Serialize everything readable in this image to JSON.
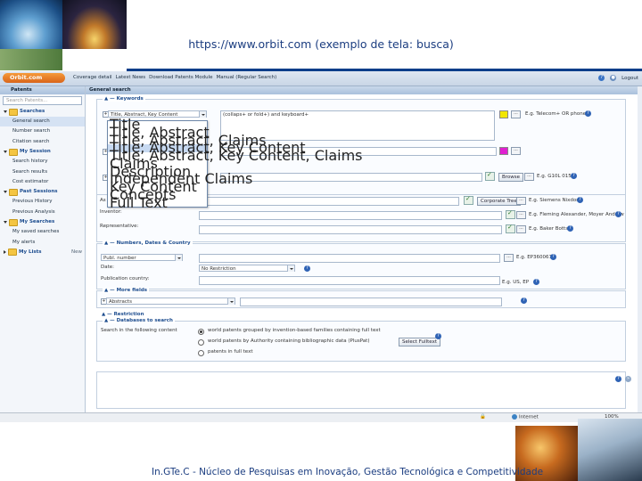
{
  "slide": {
    "title": "https://www.orbit.com (exemplo de tela: busca)",
    "footer": "In.GTe.C - Núcleo de Pesquisas em Inovação, Gestão Tecnológica e Competitividade"
  },
  "app": {
    "logo": "Orbit.com",
    "topnav": [
      "Coverage detail",
      "Latest News",
      "Download Patents Module",
      "Manual (Regular Search)"
    ],
    "logout": "Logout"
  },
  "sidebar": {
    "header": "Patents",
    "search_placeholder": "Search Patents...",
    "searches": {
      "title": "Searches",
      "items": [
        "General search",
        "Number search",
        "Citation search"
      ]
    },
    "my_session": {
      "title": "My Session",
      "items": [
        "Search history",
        "Search results",
        "Cost estimator"
      ]
    },
    "past_sessions": {
      "title": "Past Sessions",
      "items": [
        "Previous History",
        "Previous Analysis"
      ]
    },
    "my_searches": {
      "title": "My Searches",
      "items": [
        "My saved searches",
        "My alerts"
      ]
    },
    "my_lists": {
      "title": "My Lists",
      "new_label": "New"
    }
  },
  "main": {
    "header": "General search",
    "keywords": {
      "title": "Keywords",
      "field_select": "Title, Abstract, Key Content",
      "query": "(collaps+ or fold+) and keyboard+",
      "example": "E.g. Telecom+ OR phone"
    },
    "dropdown_options": [
      "Title",
      "Title, Abstract",
      "Title, Abstract, Claims",
      "Title, Abstract, Key Content",
      "Title, Abstract, Key Content, Claims",
      "Claims",
      "Description",
      "Independent Claims",
      "Key Content",
      "Concepts",
      "Full Text"
    ],
    "dropdown_highlighted": "Title, Abstract, Key Content",
    "classification": {
      "browse_label": "Browse",
      "example": "E.g. G10L 015"
    },
    "names": {
      "assignee_prefix": "As",
      "corporate_tree_label": "Corporate Tree",
      "assignee_example": "E.g. Siemens Nixdorf",
      "inventor_label": "Inventor:",
      "inventor_example": "E.g. Fleming Alexander, Moyer Andrew",
      "representative_label": "Representative:",
      "representative_example": "E.g. Baker Botts"
    },
    "numbers": {
      "title": "Numbers, Dates & Country",
      "number_select": "Publ. number",
      "number_example": "E.g. EP360067",
      "date_label": "Date:",
      "date_select": "No Restriction",
      "country_label": "Publication country:",
      "country_example": "E.g. US, EP"
    },
    "more_fields": {
      "title": "More fields",
      "select": "Abstracts"
    },
    "restriction": {
      "title": "Restriction"
    },
    "databases": {
      "title": "Databases to search",
      "label": "Search in the following content",
      "options": [
        "world patents grouped by invention-based families containing full text",
        "world patents by Authority containing bibliographic data (PlusPat)",
        "patents in full text"
      ],
      "select_fulltext_label": "Select Fulltext"
    }
  },
  "statusbar": {
    "zone": "Internet",
    "zoom": "100%"
  },
  "colors": {
    "accent": "#1d4d8f",
    "logo": "#e8782a",
    "slide_text": "#1b3d80"
  }
}
